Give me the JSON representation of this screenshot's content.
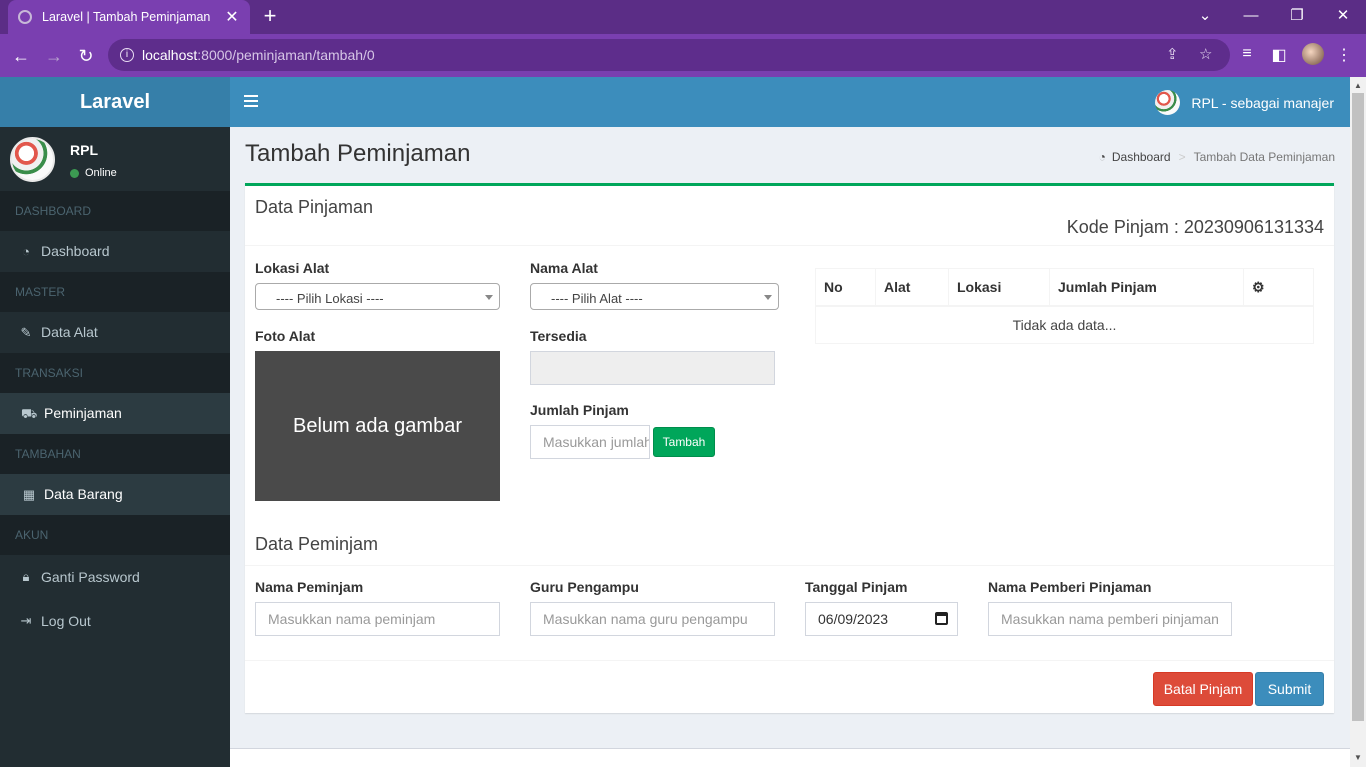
{
  "browser": {
    "tab_title": "Laravel | Tambah Peminjaman",
    "url_host": "localhost",
    "url_path": ":8000/peminjaman/tambah/0"
  },
  "sidebar": {
    "logo": "Laravel",
    "user_name": "RPL",
    "user_status": "Online",
    "sections": [
      {
        "header": "DASHBOARD",
        "items": [
          {
            "label": "Dashboard",
            "icon": "dashboard-icon"
          }
        ]
      },
      {
        "header": "MASTER",
        "items": [
          {
            "label": "Data Alat",
            "icon": "wrench-icon"
          }
        ]
      },
      {
        "header": "TRANSAKSI",
        "items": [
          {
            "label": "Peminjaman",
            "icon": "cart-icon"
          }
        ]
      },
      {
        "header": "TAMBAHAN",
        "items": [
          {
            "label": "Data Barang",
            "icon": "archive-icon"
          }
        ]
      },
      {
        "header": "AKUN",
        "items": [
          {
            "label": "Ganti Password",
            "icon": "lock-icon"
          },
          {
            "label": "Log Out",
            "icon": "sign-out-icon"
          }
        ]
      }
    ]
  },
  "header": {
    "user_label": "RPL - sebagai manajer"
  },
  "page": {
    "title": "Tambah Peminjaman",
    "breadcrumb": [
      "Dashboard",
      "Tambah Data Peminjaman"
    ]
  },
  "pinjaman": {
    "title": "Data Pinjaman",
    "kode": "Kode Pinjam : 20230906131334",
    "lokasi_label": "Lokasi Alat",
    "lokasi_value": "---- Pilih Lokasi ----",
    "nama_alat_label": "Nama Alat",
    "nama_alat_value": "---- Pilih Alat ----",
    "foto_label": "Foto Alat",
    "foto_placeholder": "Belum ada gambar",
    "tersedia_label": "Tersedia",
    "tersedia_value": "",
    "jumlah_label": "Jumlah Pinjam",
    "jumlah_placeholder": "Masukkan jumlah",
    "tambah_label": "Tambah",
    "table_headers": [
      "No",
      "Alat",
      "Lokasi",
      "Jumlah Pinjam"
    ],
    "table_empty": "Tidak ada data..."
  },
  "peminjam": {
    "title": "Data Peminjam",
    "nama_label": "Nama Peminjam",
    "nama_placeholder": "Masukkan nama peminjam",
    "guru_label": "Guru Pengampu",
    "guru_placeholder": "Masukkan nama guru pengampu",
    "tanggal_label": "Tanggal Pinjam",
    "tanggal_value": "06/09/2023",
    "pemberi_label": "Nama Pemberi Pinjaman",
    "pemberi_placeholder": "Masukkan nama pemberi pinjaman"
  },
  "actions": {
    "batal": "Batal Pinjam",
    "submit": "Submit"
  },
  "colors": {
    "header": "#3c8dbc",
    "logo": "#367fa9",
    "sidebar": "#222d32",
    "success": "#00a65a",
    "danger": "#dd4b39"
  }
}
